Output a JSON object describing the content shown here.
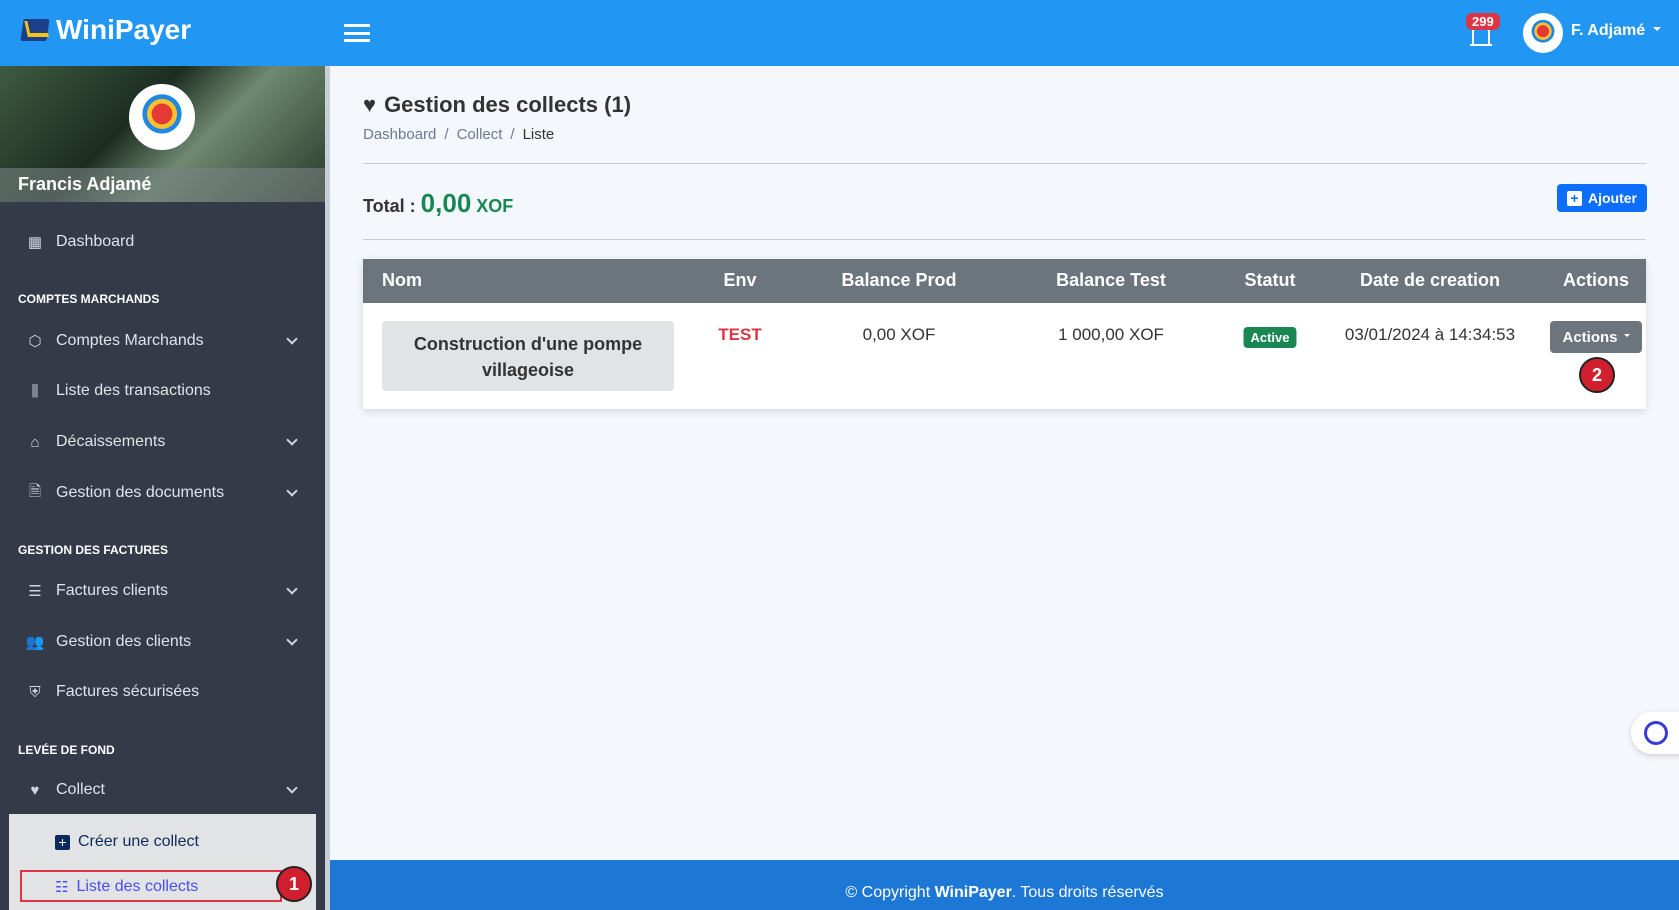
{
  "header": {
    "app_name": "WiniPayer",
    "notification_count": "299",
    "user_name": "F. Adjamé"
  },
  "sidebar": {
    "profile_name": "Francis Adjamé",
    "dashboard": "Dashboard",
    "sections": [
      {
        "title": "COMPTES MARCHANDS",
        "items": [
          "Comptes Marchands",
          "Liste des transactions",
          "Décaissements",
          "Gestion des documents"
        ]
      },
      {
        "title": "GESTION DES FACTURES",
        "items": [
          "Factures clients",
          "Gestion des clients",
          "Factures sécurisées"
        ]
      },
      {
        "title": "LEVÉE DE FOND",
        "items": [
          "Collect"
        ]
      }
    ],
    "submenu": [
      "Créer une collect",
      "Liste des collects"
    ]
  },
  "annotations": [
    "1",
    "2"
  ],
  "main": {
    "title": "Gestion des collects (1)",
    "breadcrumb": [
      "Dashboard",
      "Collect",
      "Liste"
    ],
    "breadcrumb_sep": "/",
    "total_label": "Total :",
    "total_amount": "0,00",
    "total_currency": "XOF",
    "add_button": "Ajouter",
    "table": {
      "columns": [
        "Nom",
        "Env",
        "Balance Prod",
        "Balance Test",
        "Statut",
        "Date de creation",
        "Actions"
      ],
      "rows": [
        {
          "nom": "Construction d'une pompe villageoise",
          "env": "TEST",
          "balance_prod": "0,00 XOF",
          "balance_test": "1 000,00 XOF",
          "statut": "Active",
          "date": "03/01/2024 à 14:34:53",
          "actions": "Actions"
        }
      ]
    }
  },
  "footer": {
    "prefix": "© Copyright ",
    "brand": "WiniPayer",
    "suffix": ". Tous droits réservés"
  },
  "colors": {
    "primary": "#2196f3",
    "sidebar": "#343a48",
    "success": "#198754",
    "danger": "#dc3545",
    "add_button": "#0d6efd"
  }
}
